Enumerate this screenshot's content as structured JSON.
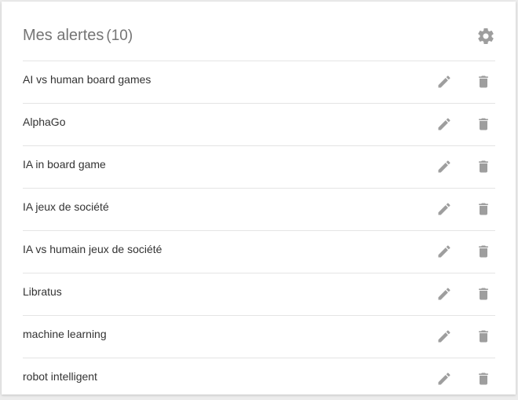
{
  "header": {
    "title": "Mes alertes",
    "count": "(10)",
    "settings_icon": "gear-icon"
  },
  "alerts": [
    {
      "label": "AI vs human board games"
    },
    {
      "label": "AlphaGo"
    },
    {
      "label": "IA in board game"
    },
    {
      "label": "IA jeux de société"
    },
    {
      "label": "IA vs humain jeux de société"
    },
    {
      "label": "Libratus"
    },
    {
      "label": "machine learning"
    },
    {
      "label": "robot intelligent"
    }
  ],
  "icons": {
    "edit": "pencil-icon",
    "delete": "trash-icon"
  },
  "colors": {
    "title": "#757575",
    "text": "#333333",
    "icon": "#9e9e9e",
    "divider": "#e4e4e4"
  }
}
